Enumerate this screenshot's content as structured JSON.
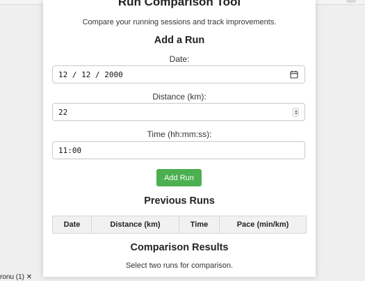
{
  "app": {
    "title": "Run Comparison Tool",
    "subtitle": "Compare your running sessions and track improvements."
  },
  "add_run": {
    "heading": "Add a Run",
    "date": {
      "label": "Date:",
      "value": "12 / 12 / 2000"
    },
    "distance": {
      "label": "Distance (km):",
      "value": "22"
    },
    "time": {
      "label": "Time (hh:mm:ss):",
      "value": "11:00"
    },
    "button_label": "Add Run"
  },
  "previous_runs": {
    "heading": "Previous Runs",
    "columns": [
      "Date",
      "Distance (km)",
      "Time",
      "Pace (min/km)"
    ]
  },
  "comparison": {
    "heading": "Comparison Results",
    "message": "Select two runs for comparison."
  },
  "overlay_text": "ronu (1) ✕",
  "colors": {
    "accent": "#4caf50"
  }
}
